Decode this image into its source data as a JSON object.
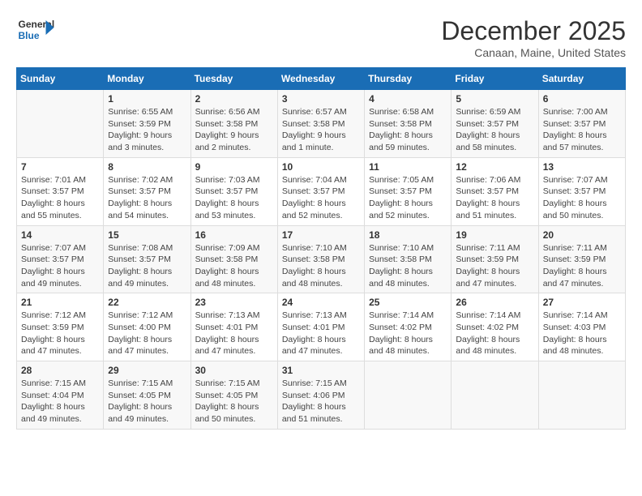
{
  "logo": {
    "line1": "General",
    "line2": "Blue"
  },
  "title": "December 2025",
  "location": "Canaan, Maine, United States",
  "weekdays": [
    "Sunday",
    "Monday",
    "Tuesday",
    "Wednesday",
    "Thursday",
    "Friday",
    "Saturday"
  ],
  "weeks": [
    [
      {
        "day": "",
        "info": ""
      },
      {
        "day": "1",
        "info": "Sunrise: 6:55 AM\nSunset: 3:59 PM\nDaylight: 9 hours\nand 3 minutes."
      },
      {
        "day": "2",
        "info": "Sunrise: 6:56 AM\nSunset: 3:58 PM\nDaylight: 9 hours\nand 2 minutes."
      },
      {
        "day": "3",
        "info": "Sunrise: 6:57 AM\nSunset: 3:58 PM\nDaylight: 9 hours\nand 1 minute."
      },
      {
        "day": "4",
        "info": "Sunrise: 6:58 AM\nSunset: 3:58 PM\nDaylight: 8 hours\nand 59 minutes."
      },
      {
        "day": "5",
        "info": "Sunrise: 6:59 AM\nSunset: 3:57 PM\nDaylight: 8 hours\nand 58 minutes."
      },
      {
        "day": "6",
        "info": "Sunrise: 7:00 AM\nSunset: 3:57 PM\nDaylight: 8 hours\nand 57 minutes."
      }
    ],
    [
      {
        "day": "7",
        "info": "Sunrise: 7:01 AM\nSunset: 3:57 PM\nDaylight: 8 hours\nand 55 minutes."
      },
      {
        "day": "8",
        "info": "Sunrise: 7:02 AM\nSunset: 3:57 PM\nDaylight: 8 hours\nand 54 minutes."
      },
      {
        "day": "9",
        "info": "Sunrise: 7:03 AM\nSunset: 3:57 PM\nDaylight: 8 hours\nand 53 minutes."
      },
      {
        "day": "10",
        "info": "Sunrise: 7:04 AM\nSunset: 3:57 PM\nDaylight: 8 hours\nand 52 minutes."
      },
      {
        "day": "11",
        "info": "Sunrise: 7:05 AM\nSunset: 3:57 PM\nDaylight: 8 hours\nand 52 minutes."
      },
      {
        "day": "12",
        "info": "Sunrise: 7:06 AM\nSunset: 3:57 PM\nDaylight: 8 hours\nand 51 minutes."
      },
      {
        "day": "13",
        "info": "Sunrise: 7:07 AM\nSunset: 3:57 PM\nDaylight: 8 hours\nand 50 minutes."
      }
    ],
    [
      {
        "day": "14",
        "info": "Sunrise: 7:07 AM\nSunset: 3:57 PM\nDaylight: 8 hours\nand 49 minutes."
      },
      {
        "day": "15",
        "info": "Sunrise: 7:08 AM\nSunset: 3:57 PM\nDaylight: 8 hours\nand 49 minutes."
      },
      {
        "day": "16",
        "info": "Sunrise: 7:09 AM\nSunset: 3:58 PM\nDaylight: 8 hours\nand 48 minutes."
      },
      {
        "day": "17",
        "info": "Sunrise: 7:10 AM\nSunset: 3:58 PM\nDaylight: 8 hours\nand 48 minutes."
      },
      {
        "day": "18",
        "info": "Sunrise: 7:10 AM\nSunset: 3:58 PM\nDaylight: 8 hours\nand 48 minutes."
      },
      {
        "day": "19",
        "info": "Sunrise: 7:11 AM\nSunset: 3:59 PM\nDaylight: 8 hours\nand 47 minutes."
      },
      {
        "day": "20",
        "info": "Sunrise: 7:11 AM\nSunset: 3:59 PM\nDaylight: 8 hours\nand 47 minutes."
      }
    ],
    [
      {
        "day": "21",
        "info": "Sunrise: 7:12 AM\nSunset: 3:59 PM\nDaylight: 8 hours\nand 47 minutes."
      },
      {
        "day": "22",
        "info": "Sunrise: 7:12 AM\nSunset: 4:00 PM\nDaylight: 8 hours\nand 47 minutes."
      },
      {
        "day": "23",
        "info": "Sunrise: 7:13 AM\nSunset: 4:01 PM\nDaylight: 8 hours\nand 47 minutes."
      },
      {
        "day": "24",
        "info": "Sunrise: 7:13 AM\nSunset: 4:01 PM\nDaylight: 8 hours\nand 47 minutes."
      },
      {
        "day": "25",
        "info": "Sunrise: 7:14 AM\nSunset: 4:02 PM\nDaylight: 8 hours\nand 48 minutes."
      },
      {
        "day": "26",
        "info": "Sunrise: 7:14 AM\nSunset: 4:02 PM\nDaylight: 8 hours\nand 48 minutes."
      },
      {
        "day": "27",
        "info": "Sunrise: 7:14 AM\nSunset: 4:03 PM\nDaylight: 8 hours\nand 48 minutes."
      }
    ],
    [
      {
        "day": "28",
        "info": "Sunrise: 7:15 AM\nSunset: 4:04 PM\nDaylight: 8 hours\nand 49 minutes."
      },
      {
        "day": "29",
        "info": "Sunrise: 7:15 AM\nSunset: 4:05 PM\nDaylight: 8 hours\nand 49 minutes."
      },
      {
        "day": "30",
        "info": "Sunrise: 7:15 AM\nSunset: 4:05 PM\nDaylight: 8 hours\nand 50 minutes."
      },
      {
        "day": "31",
        "info": "Sunrise: 7:15 AM\nSunset: 4:06 PM\nDaylight: 8 hours\nand 51 minutes."
      },
      {
        "day": "",
        "info": ""
      },
      {
        "day": "",
        "info": ""
      },
      {
        "day": "",
        "info": ""
      }
    ]
  ]
}
